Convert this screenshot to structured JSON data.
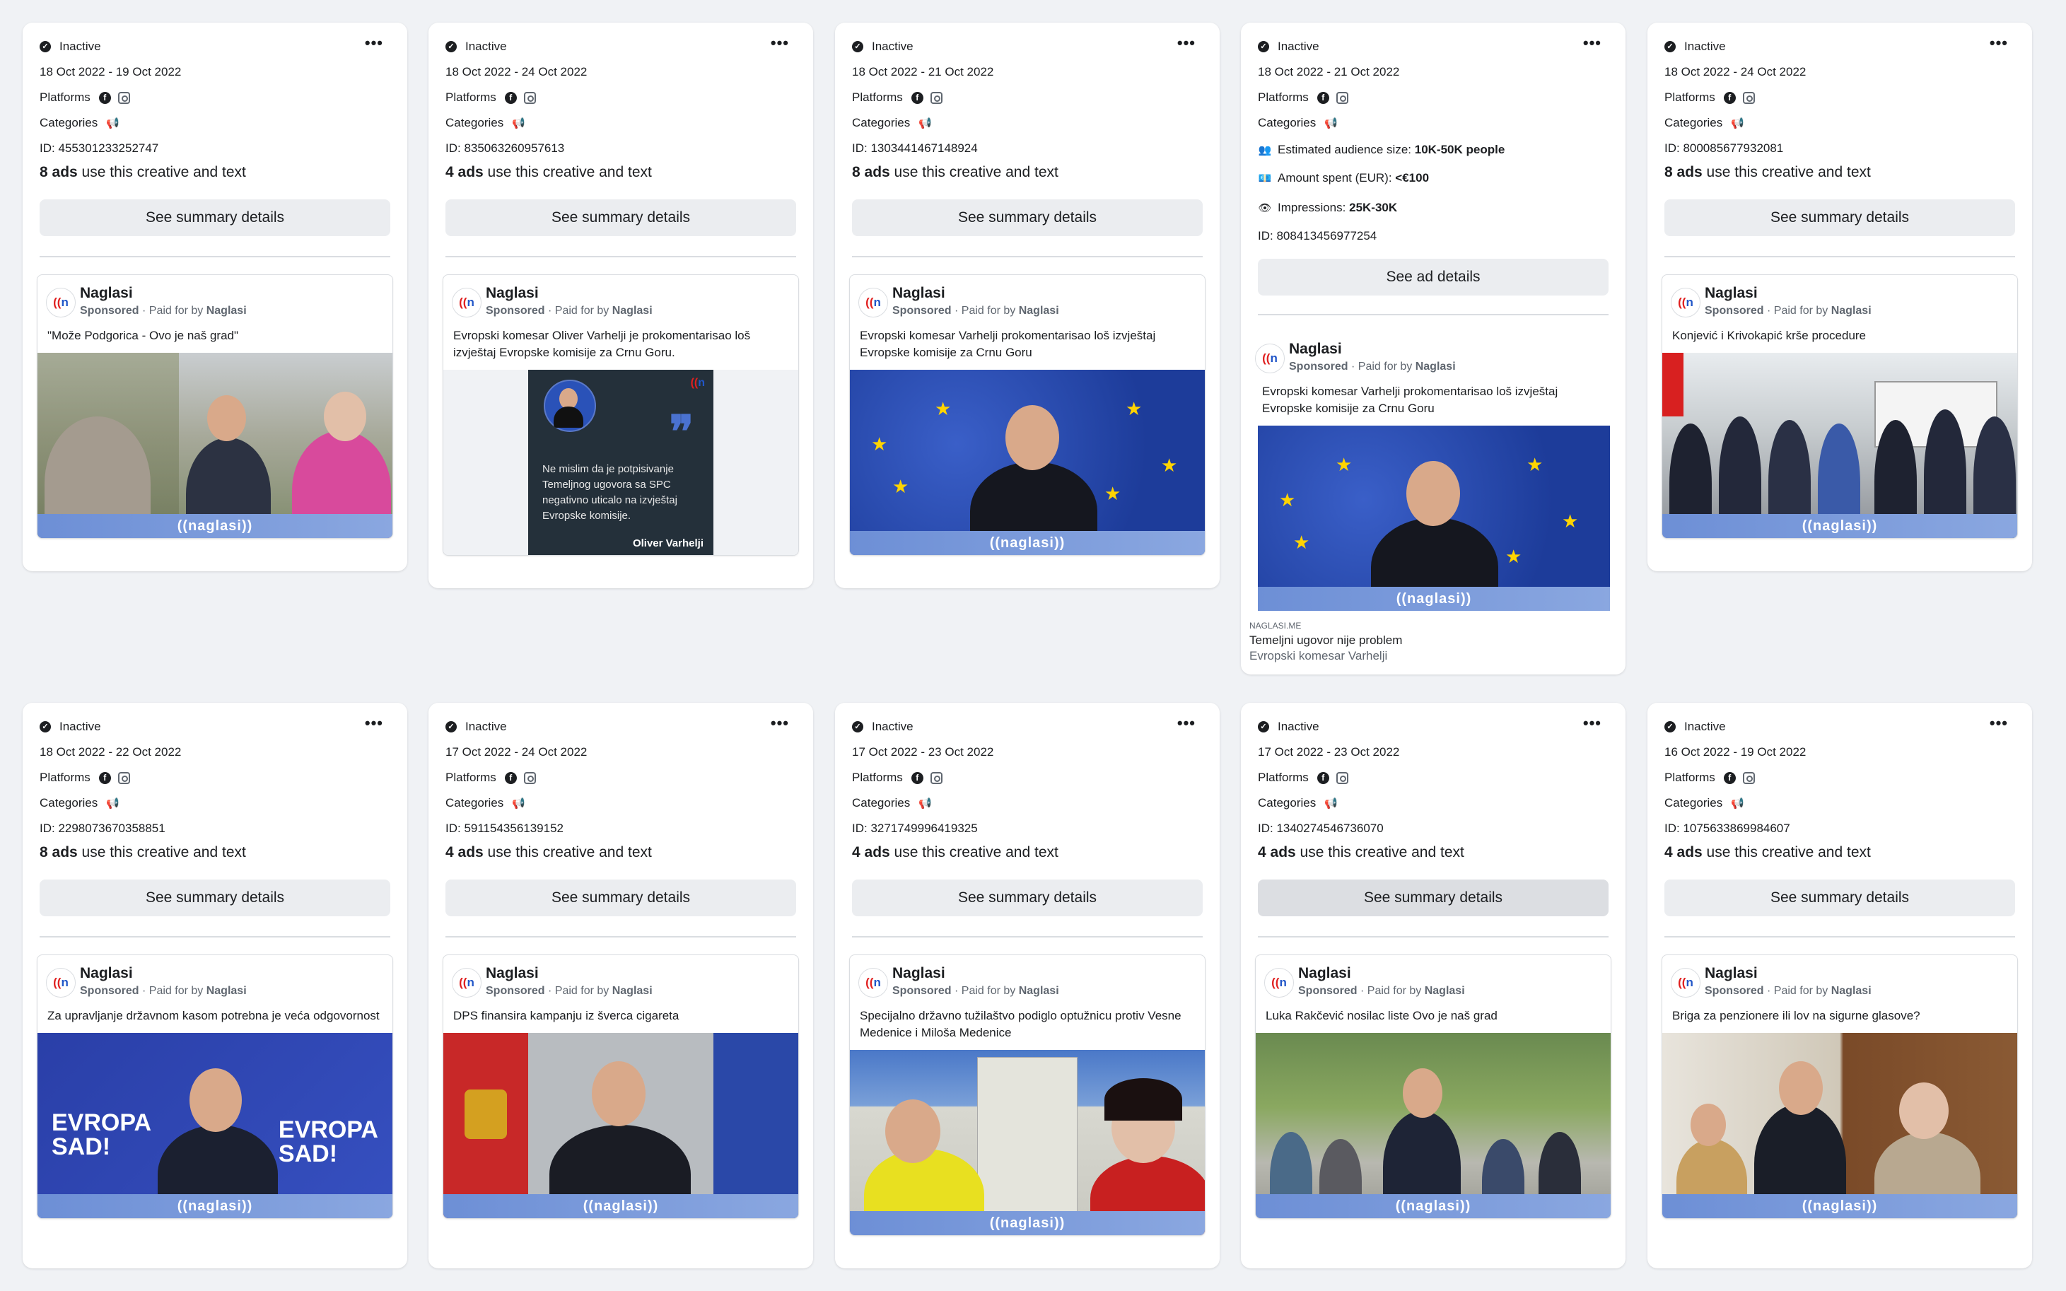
{
  "more_glyph": "•••",
  "paid_prefix": "Paid for by",
  "cards": [
    {
      "status": "Inactive",
      "dates": "18 Oct 2022 - 19 Oct 2022",
      "platforms_label": "Platforms",
      "categories_label": "Categories",
      "id": "ID: 455301233252747",
      "ads_count": "8 ads",
      "ads_suffix": " use this creative and text",
      "button": "See summary details",
      "ad": {
        "name": "Naglasi",
        "sponsored": "Sponsored",
        "payer": "Naglasi",
        "text": "\"Može Podgorica - Ovo je naš grad\"",
        "band": "((naglasi))"
      }
    },
    {
      "status": "Inactive",
      "dates": "18 Oct 2022 - 24 Oct 2022",
      "platforms_label": "Platforms",
      "categories_label": "Categories",
      "id": "ID: 835063260957613",
      "ads_count": "4 ads",
      "ads_suffix": " use this creative and text",
      "button": "See summary details",
      "ad": {
        "name": "Naglasi",
        "sponsored": "Sponsored",
        "payer": "Naglasi",
        "text": "Evropski komesar Oliver Varhelji je prokomentarisao loš izvještaj Evropske komisije za Crnu Goru.",
        "quote": "Ne mislim da je potpisivanje Temeljnog ugovora sa SPC negativno uticalo na izvještaj Evropske komisije.",
        "quote_author": "Oliver Varhelji"
      }
    },
    {
      "status": "Inactive",
      "dates": "18 Oct 2022 - 21 Oct 2022",
      "platforms_label": "Platforms",
      "categories_label": "Categories",
      "id": "ID: 1303441467148924",
      "ads_count": "8 ads",
      "ads_suffix": " use this creative and text",
      "button": "See summary details",
      "ad": {
        "name": "Naglasi",
        "sponsored": "Sponsored",
        "payer": "Naglasi",
        "text": "Evropski komesar Varhelji prokomentarisao loš izvještaj Evropske komisije za Crnu Goru",
        "band": "((naglasi))"
      }
    },
    {
      "status": "Inactive",
      "dates": "18 Oct 2022 - 21 Oct 2022",
      "platforms_label": "Platforms",
      "categories_label": "Categories",
      "audience_label": "Estimated audience size:",
      "audience_value": "10K-50K people",
      "spent_label": "Amount spent (EUR):",
      "spent_value": "<€100",
      "impressions_label": "Impressions:",
      "impressions_value": "25K-30K",
      "id": "ID: 808413456977254",
      "button": "See ad details",
      "ad": {
        "name": "Naglasi",
        "sponsored": "Sponsored",
        "payer": "Naglasi",
        "text": "Evropski komesar Varhelji prokomentarisao loš izvještaj Evropske komisije za Crnu Goru",
        "band": "((naglasi))",
        "link_domain": "NAGLASI.ME",
        "link_title": "Temeljni ugovor nije problem",
        "link_desc": "Evropski komesar Varhelji"
      }
    },
    {
      "status": "Inactive",
      "dates": "18 Oct 2022 - 24 Oct 2022",
      "platforms_label": "Platforms",
      "categories_label": "Categories",
      "id": "ID: 800085677932081",
      "ads_count": "8 ads",
      "ads_suffix": " use this creative and text",
      "button": "See summary details",
      "ad": {
        "name": "Naglasi",
        "sponsored": "Sponsored",
        "payer": "Naglasi",
        "text": "Konjević i Krivokapić krše procedure",
        "band": "((naglasi))"
      }
    },
    {
      "status": "Inactive",
      "dates": "18 Oct 2022 - 22 Oct 2022",
      "platforms_label": "Platforms",
      "categories_label": "Categories",
      "id": "ID: 2298073670358851",
      "ads_count": "8 ads",
      "ads_suffix": " use this creative and text",
      "button": "See summary details",
      "ad": {
        "name": "Naglasi",
        "sponsored": "Sponsored",
        "payer": "Naglasi",
        "text": "Za upravljanje državnom kasom potrebna je veća odgovornost",
        "band": "((naglasi))"
      }
    },
    {
      "status": "Inactive",
      "dates": "17 Oct 2022 - 24 Oct 2022",
      "platforms_label": "Platforms",
      "categories_label": "Categories",
      "id": "ID: 591154356139152",
      "ads_count": "4 ads",
      "ads_suffix": " use this creative and text",
      "button": "See summary details",
      "ad": {
        "name": "Naglasi",
        "sponsored": "Sponsored",
        "payer": "Naglasi",
        "text": "DPS finansira kampanju iz šverca cigareta",
        "band": "((naglasi))"
      }
    },
    {
      "status": "Inactive",
      "dates": "17 Oct 2022 - 23 Oct 2022",
      "platforms_label": "Platforms",
      "categories_label": "Categories",
      "id": "ID: 3271749996419325",
      "ads_count": "4 ads",
      "ads_suffix": " use this creative and text",
      "button": "See summary details",
      "ad": {
        "name": "Naglasi",
        "sponsored": "Sponsored",
        "payer": "Naglasi",
        "text": "Specijalno državno tužilaštvo podiglo optužnicu protiv Vesne Medenice i Miloša Medenice",
        "band": "((naglasi))"
      }
    },
    {
      "status": "Inactive",
      "dates": "17 Oct 2022 - 23 Oct 2022",
      "platforms_label": "Platforms",
      "categories_label": "Categories",
      "id": "ID: 1340274546736070",
      "ads_count": "4 ads",
      "ads_suffix": " use this creative and text",
      "button": "See summary details",
      "ad": {
        "name": "Naglasi",
        "sponsored": "Sponsored",
        "payer": "Naglasi",
        "text": "Luka Rakčević nosilac liste Ovo je naš grad",
        "band": "((naglasi))"
      }
    },
    {
      "status": "Inactive",
      "dates": "16 Oct 2022 - 19 Oct 2022",
      "platforms_label": "Platforms",
      "categories_label": "Categories",
      "id": "ID: 1075633869984607",
      "ads_count": "4 ads",
      "ads_suffix": " use this creative and text",
      "button": "See summary details",
      "ad": {
        "name": "Naglasi",
        "sponsored": "Sponsored",
        "payer": "Naglasi",
        "text": "Briga za penzionere ili lov na sigurne glasove?",
        "band": "((naglasi))"
      }
    }
  ]
}
